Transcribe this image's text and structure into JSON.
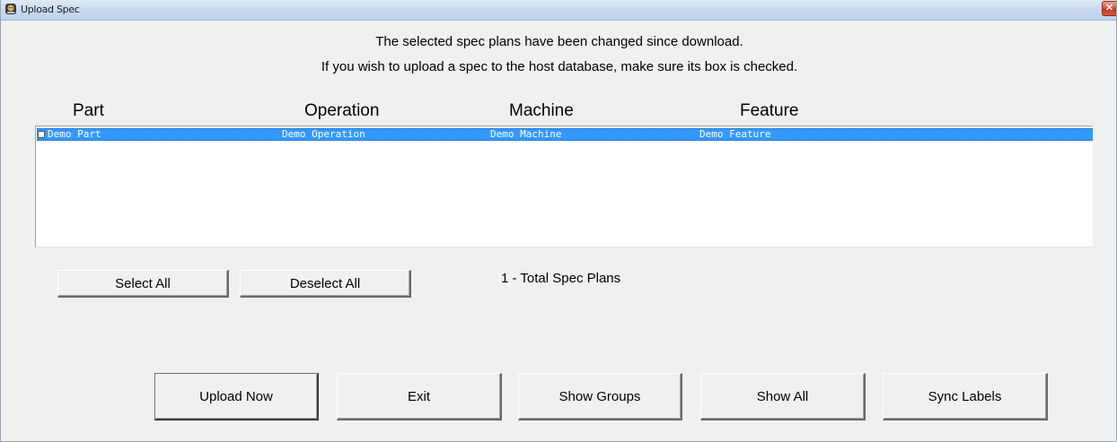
{
  "window": {
    "title": "Upload Spec",
    "close_glyph": "✕"
  },
  "messages": {
    "line1": "The selected spec plans have been changed since download.",
    "line2": "If you wish to upload a spec to the host database, make sure its box is checked."
  },
  "list": {
    "columns": {
      "part": "Part",
      "operation": "Operation",
      "machine": "Machine",
      "feature": "Feature"
    },
    "rows": [
      {
        "checked": false,
        "selected": true,
        "part": "Demo Part",
        "operation": "Demo Operation",
        "machine": "Demo Machine",
        "feature": "Demo Feature"
      }
    ]
  },
  "selection": {
    "select_all_label": "Select All",
    "deselect_all_label": "Deselect All",
    "total_label": "1 - Total Spec Plans"
  },
  "actions": {
    "upload_now_label": "Upload Now",
    "exit_label": "Exit",
    "show_groups_label": "Show Groups",
    "show_all_label": "Show All",
    "sync_labels_label": "Sync Labels"
  },
  "colors": {
    "selection_highlight": "#3399ff",
    "window_background": "#f0f0f0",
    "close_button": "#c7361d"
  },
  "icons": {
    "app": "app-icon",
    "close": "close-icon"
  }
}
